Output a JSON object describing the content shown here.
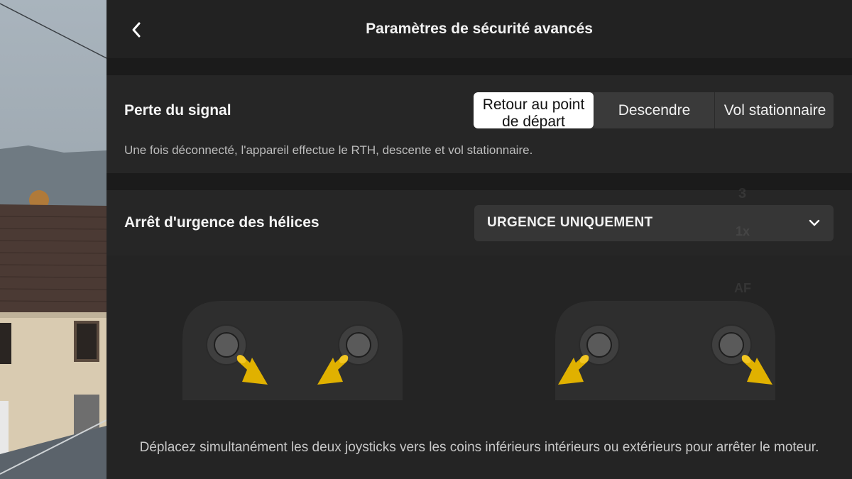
{
  "header": {
    "title": "Paramètres de sécurité avancés",
    "back_icon": "chevron-left-icon"
  },
  "signal_loss": {
    "label": "Perte du signal",
    "options": [
      {
        "label": "Retour au point de départ",
        "selected": true
      },
      {
        "label": "Descendre",
        "selected": false
      },
      {
        "label": "Vol stationnaire",
        "selected": false
      }
    ],
    "description": "Une fois déconnecté, l'appareil effectue le RTH, descente et vol stationnaire."
  },
  "propeller_stop": {
    "label": "Arrêt d'urgence des hélices",
    "selected_value": "URGENCE UNIQUEMENT",
    "dropdown_icon": "chevron-down-icon"
  },
  "illustration": {
    "hint": "Déplacez simultanément les deux joysticks vers les coins inférieurs intérieurs ou extérieurs pour arrêter le moteur.",
    "arrow_color": "#e0b100",
    "remote_icons": [
      "remote-inner-corners-icon",
      "remote-outer-corners-icon"
    ]
  },
  "background_overlay": {
    "labels": [
      "3",
      "1x",
      "AF"
    ]
  },
  "colors": {
    "panel": "#232323",
    "section": "#262626",
    "segment_active": "#ffffff",
    "segment_inactive": "#3a3a3a",
    "accent_yellow": "#e0b100"
  }
}
